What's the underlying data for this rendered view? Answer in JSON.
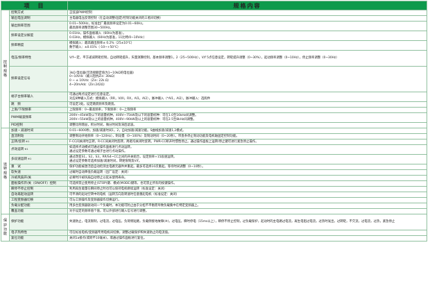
{
  "header": {
    "item": "项　目",
    "spec": "规格内容"
  },
  "sections": [
    {
      "category": "控制规格",
      "rows": [
        {
          "label": "控制方式",
          "h": 8,
          "lines": [
            "正弦波PWM控制"
          ]
        },
        {
          "label": "输出电压调制",
          "h": 8,
          "lines": [
            "主电器电压反馈控制（在自动调整/固定/控制功能关闭的三者间切换）"
          ]
        },
        {
          "label": "输出频率范围",
          "h": 14,
          "lines": [
            "0.01~500Hz，标准出厂最高频率设定为0.01~60Hz。",
            "最高频率调整范围30~500Hz。"
          ]
        },
        {
          "label": "频率设定分解度",
          "h": 14,
          "lines": [
            "0.01Hz，操作面板输入（60Hz为基准）。",
            "0.03Hz，模拟输入（60Hz为基准，11比特/0~10Vdc）"
          ]
        },
        {
          "label": "频率精度",
          "h": 14,
          "lines": [
            "模拟输入：最高输出频率± 0.2%（25±10℃）",
            "数字输入：±0.01%（-10~+50℃）"
          ]
        },
        {
          "label": "电压/频率特性",
          "h": 23,
          "lines": [
            "V/f一定，平方递减转矩控制，自动转矩提升，矢量演算控制，基本频率调整1，2（25~500Hz），V/f 5点任意设定，转矩提升调整（0~30%），起动频率调整（0~10Hz），停止频率调整（0~30Hz）"
          ]
        },
        {
          "label": "频率设定信号",
          "h": 37,
          "lines": [
            "3kΩ 电位器(可连接额定值为1~10kΩ的电位器)",
            "0~10Vdc（输入阻抗Zin: 30kΩ）",
            "0 ~ ± 10Vdc（Zin: 22k Ω）",
            "4~20mAdc（Zin:242Ω）"
          ]
        },
        {
          "label": "端子台频率输入",
          "h": 14,
          "lines": [
            "可通过两点设定进行任意设定。",
            "对应8种输入方式：模拟输入（RR，VI/II，RX，AI1，AI2），脉冲输入（*AI1，AI2），脉冲输入：选购件"
          ]
        },
        {
          "label": "跳　频",
          "h": 8,
          "lines": [
            "可设定3处。设定跳跃频率及跳宽。"
          ]
        },
        {
          "label": "上限/下限频率",
          "h": 8,
          "lines": [
            "上限频率：0~最高频率，下限频率：0~上限频率"
          ]
        },
        {
          "label": "PWM载波频率",
          "h": 14,
          "lines": [
            "200V~45kW及以下的容量机种，400V~75kW及以下的容量机种：可在1.0至16kHz间调整。",
            "200V~55kW及以上的容量机种，400V~90kW及以上的容量机种：可在2.5至8kHz间调整。"
          ]
        },
        {
          "label": "PID控制",
          "h": 8,
          "lines": [
            "调整比例增益，积分时间，微分时间及滞后滤波。"
          ]
        }
      ]
    },
    {
      "category": "运转规格",
      "rows": [
        {
          "label": "加速・减速时间",
          "h": 8,
          "lines": [
            "0.01~6000秒。加速/减速时间1，2，自动加速/减速功能。S曲线加速/减速1,2模式。"
          ]
        },
        {
          "label": "直流制动",
          "h": 8,
          "lines": [
            "调整制动开始频率（0~120Hz），制动量（0~100%）及制动时间（0~20秒）。带直条停止制动功能及电机轴固定控制功能。"
          ]
        },
        {
          "label": "正转/反转",
          "note": "※1",
          "h": 8,
          "lines": [
            "F-CC间关闭时正转，R-CC间关闭时反转，两者均关闭时反转。PWR-CC断开时惯性停止。通过操作面板上运转/停止键可进行紧急停止操作。"
          ]
        },
        {
          "label": "点动运转",
          "note": "※1",
          "h": 14,
          "lines": [
            "如选择点动模式可通过操作面板进行点动运转。",
            "通过设定参数可通过端子台进行点动操作。"
          ]
        },
        {
          "label": "多段速运转",
          "note": "※1",
          "h": 14,
          "lines": [
            "通过改变S1，S2，S3，RR/S4~CC之间的开关组合，设定频率+15段速运转。",
            "通过设定参数可选择加速/减速时间，转矩限制及V/f。"
          ]
        },
        {
          "label": "重　试",
          "h": 8,
          "lines": [
            "保护功能被激活后自动检测主电路元器件并重起。最多可选择10次重起。等待时间调整（0~10秒）。"
          ]
        },
        {
          "label": "软失速",
          "h": 8,
          "lines": [
            "过载时自动降低负载运转（出厂设定：关闭）"
          ]
        },
        {
          "label": "冷却风扇开/关",
          "h": 8,
          "lines": [
            "必要时冷却风扇自动停止以延长使用寿命。"
          ]
        },
        {
          "label": "面板操作开/关（ON/OFF）控制",
          "h": 8,
          "lines": [
            "可选择禁止使用停止(STOP)键、模式(MODE)键等，也可禁止所有的按键操作。"
          ]
        },
        {
          "label": "瞬停不停止控制",
          "h": 8,
          "lines": [
            "利用再生能量在瞬间停止时也可以保持电机继续运转（标准设定：关闭）"
          ]
        },
        {
          "label": "自动再起动运转",
          "h": 8,
          "lines": [
            "可平滑的起动空转中的电机（运转方向及转速时任意重起电机（标准设定：关闭）"
          ]
        },
        {
          "label": "工程变频器切换",
          "h": 8,
          "lines": [
            "可与工频操作及变频器操作切换运行。"
          ]
        },
        {
          "label": "负载分配功能",
          "h": 8,
          "lines": [
            "用多台变频器驱动同一个负载时，本功能可防止由于分担不平衡而导致负载集中在特定变频器上。"
          ]
        },
        {
          "label": "覆盖功能",
          "h": 8,
          "lines": [
            "对于设定的频率值个值，可以外部进行输入信号进行调整。"
          ]
        }
      ]
    },
    {
      "category": "保护功能",
      "rows": [
        {
          "label": "保护功能",
          "h": 23,
          "lines": [
            "失速防止，电流限制，过电流，过电压，负荷侧短路，负载侧接地故障(※)，过电压，瞬时停电（15ms以上），瞬停不停止控制，过负载保护，起动时的主电路过电流，再生电阻过电流，过热时发出，过转矩，不欠流，过电流，过热，紧急停止"
          ]
        },
        {
          "label": "电子热特性",
          "h": 8,
          "lines": [
            "可在标准电机/变频器专用电机间切换，调整过载保护和失速防止的电流值。"
          ]
        },
        {
          "label": "复位功能",
          "h": 8,
          "lines": [
            "关闭1a接点(或跨不10毫米)，或通过操作面板进行复位。"
          ]
        }
      ]
    }
  ]
}
